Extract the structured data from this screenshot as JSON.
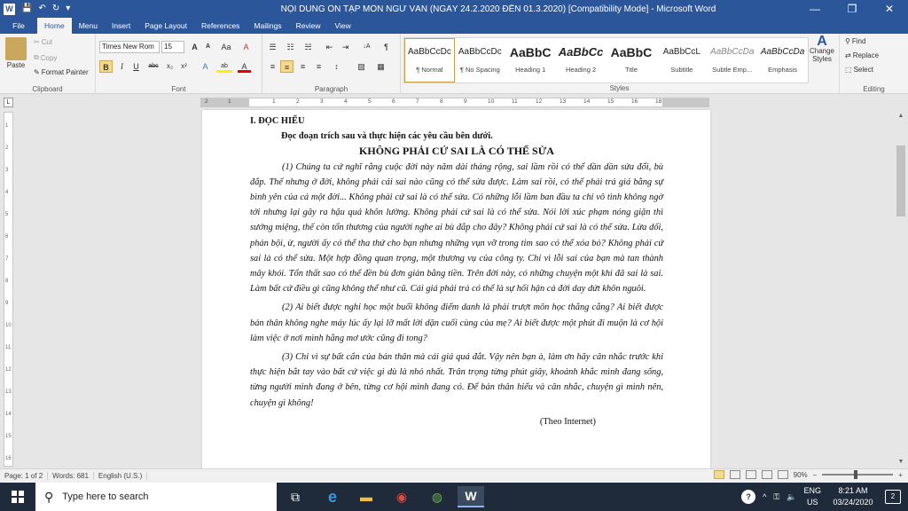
{
  "window": {
    "title": "NỘI DUNG ÔN TẬP MÔN NGỮ VĂN (NGÀY 24.2.2020 ĐẾN 01.3.2020) [Compatibility Mode] - Microsoft Word",
    "app_logo": "W",
    "qa_save": "💾",
    "qa_undo": "↶",
    "qa_redo": "↻",
    "qa_more": "▾",
    "minimize": "—",
    "restore": "❐",
    "close": "✕"
  },
  "tabs": [
    "File",
    "Home",
    "Menu",
    "Insert",
    "Page Layout",
    "References",
    "Mailings",
    "Review",
    "View"
  ],
  "ribbon": {
    "clipboard": {
      "label": "Clipboard",
      "paste": "Paste",
      "cut": "Cut",
      "copy": "Copy",
      "format_painter": "Format Painter"
    },
    "font": {
      "label": "Font",
      "family": "Times New Rom",
      "size": "15",
      "grow": "A",
      "shrink": "A",
      "change_case": "Aa",
      "clear": "A",
      "bold": "B",
      "italic": "I",
      "underline": "U",
      "strike": "abc",
      "subscript": "x₂",
      "superscript": "x²",
      "effects": "A",
      "highlight": "ab",
      "color": "A"
    },
    "paragraph": {
      "label": "Paragraph",
      "bullets": "☰",
      "numbering": "☷",
      "multilevel": "☵",
      "decrease_indent": "⇤",
      "increase_indent": "⇥",
      "sort": "↓A",
      "show_marks": "¶",
      "align_left": "≡",
      "align_center": "≡",
      "align_right": "≡",
      "justify": "≡",
      "line_spacing": "↕",
      "shading": "▨",
      "borders": "▦"
    },
    "styles": {
      "label": "Styles",
      "items": [
        {
          "sample": "AaBbCcDc",
          "name": "¶ Normal"
        },
        {
          "sample": "AaBbCcDc",
          "name": "¶ No Spacing"
        },
        {
          "sample": "AaBbC",
          "name": "Heading 1"
        },
        {
          "sample": "AaBbCc",
          "name": "Heading 2"
        },
        {
          "sample": "AaBbC",
          "name": "Title"
        },
        {
          "sample": "AaBbCcL",
          "name": "Subtitle"
        },
        {
          "sample": "AaBbCcDa",
          "name": "Subtle Emp..."
        },
        {
          "sample": "AaBbCcDa",
          "name": "Emphasis"
        }
      ],
      "change_styles": "Change Styles"
    },
    "editing": {
      "label": "Editing",
      "find": "Find",
      "replace": "Replace",
      "select": "Select"
    }
  },
  "ruler": {
    "numbers": [
      "2",
      "1",
      "1",
      "2",
      "3",
      "4",
      "5",
      "6",
      "7",
      "8",
      "9",
      "10",
      "11",
      "12",
      "13",
      "14",
      "15",
      "16",
      "18"
    ],
    "vertical": [
      "1",
      "2",
      "3",
      "4",
      "5",
      "6",
      "7",
      "8",
      "9",
      "10",
      "11",
      "12",
      "13",
      "14",
      "15",
      "16"
    ]
  },
  "document": {
    "section": "I. ĐỌC HIỂU",
    "instruction": "Đọc đoạn trích sau và thực hiện các yêu cầu bên dưới.",
    "title": "KHÔNG PHẢI CỨ SAI LÀ CÓ THỂ SỬA",
    "paragraphs": [
      "(1) Chúng ta cứ nghĩ rằng cuộc đời này năm dài tháng rộng, sai lầm rồi có thể dần dần sửa đổi, bù đắp. Thế nhưng ở đời, không phải cái sai nào cũng có thể sửa được. Làm sai rồi, có thể phải trả giá bằng sự bình yên của cả một đời... Không phải cứ sai là có thể sửa. Có những lỗi lầm ban đầu ta chỉ vô tình không ngờ tới nhưng lại gây ra hậu quả khôn lường. Không phải cứ sai là có thể sửa. Nói lời xúc phạm nóng giận thì sướng miệng, thế còn tổn thương của người nghe ai bù đắp cho đây? Không phải cứ sai là có thể sửa. Lừa dối, phản bội, ừ, người ấy có thể tha thứ cho bạn nhưng những vụn vỡ trong tim sao có thể xóa bỏ? Không phải cứ sai là có thể sửa. Một hợp đồng quan trọng, một thương vụ của công ty. Chỉ vì lỗi sai của bạn mà tan thành mây khói. Tổn thất sao có thể đền bù đơn giản bằng tiền. Trên đời này, có những chuyện một khi đã sai là sai. Làm bất cứ điều gì cũng không thể như cũ. Cái giá phải trả có thể là sự hối hận cả đời day dứt khôn nguôi.",
      "(2) Ai biết được nghỉ học một buổi không điểm danh là phải trượt môn học thẳng cẳng? Ai biết được bản thân không nghe máy lúc ấy lại lỡ mất lời dặn cuối cùng của mẹ? Ai biết được một phút đi muộn là cơ hội làm việc ở nơi mình hằng mơ ước cũng đi tong?",
      "(3) Chỉ vì sự bất cẩn của bản thân mà cái giá quá đắt. Vậy nên bạn à, làm ơn hãy cân nhắc trước khi thực hiện bắt tay vào bất cứ việc gì dù là nhỏ nhất. Trân trọng từng phút giây, khoảnh khắc mình đang sống, từng người mình đang ở bên, từng cơ hội mình đang có. Để bản thân hiểu và cân nhắc, chuyện gì mình nên, chuyện gì không!"
    ],
    "source": "(Theo Internet)"
  },
  "statusbar": {
    "page": "Page: 1 of 2",
    "words": "Words: 681",
    "language": "English (U.S.)",
    "zoom": "90%",
    "zoom_out": "−",
    "zoom_in": "+"
  },
  "taskbar": {
    "search_placeholder": "Type here to search",
    "search_icon": "⚲",
    "apps": [
      {
        "name": "task-view",
        "glyph": "⧉"
      },
      {
        "name": "edge",
        "glyph": "e"
      },
      {
        "name": "file-explorer",
        "glyph": "▬"
      },
      {
        "name": "chrome",
        "glyph": "◉"
      },
      {
        "name": "app-green",
        "glyph": "◍"
      },
      {
        "name": "word",
        "glyph": "W"
      }
    ],
    "lang_top": "ENG",
    "lang_bottom": "US",
    "time": "8:21 AM",
    "date": "03/24/2020",
    "help": "?",
    "tray_arrow": "^",
    "network": "⚿",
    "volume": "🔈",
    "notifications": "2"
  },
  "colors": {
    "titlebar": "#2b579a",
    "taskbar": "#1f2b3a",
    "highlight": "#f5d98b"
  }
}
